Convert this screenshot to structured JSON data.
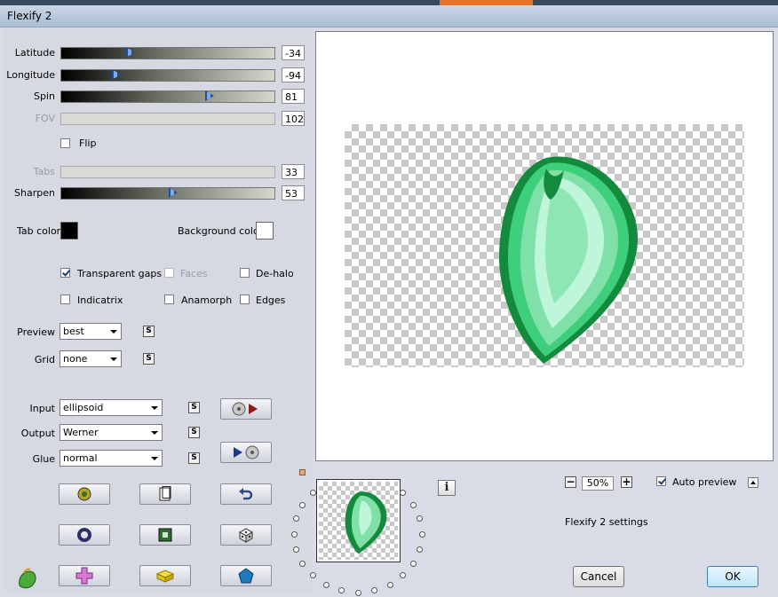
{
  "window": {
    "title": "Flexify 2"
  },
  "sliders": [
    {
      "key": "latitude",
      "label": "Latitude",
      "value": "-34",
      "fraction": 0.32,
      "enabled": true
    },
    {
      "key": "longitude",
      "label": "Longitude",
      "value": "-94",
      "fraction": 0.25,
      "enabled": true
    },
    {
      "key": "spin",
      "label": "Spin",
      "value": "81",
      "fraction": 0.71,
      "enabled": true
    },
    {
      "key": "fov",
      "label": "FOV",
      "value": "102",
      "enabled": false
    },
    {
      "key": "tabs",
      "label": "Tabs",
      "value": "33",
      "enabled": false
    },
    {
      "key": "sharpen",
      "label": "Sharpen",
      "value": "53",
      "fraction": 0.53,
      "enabled": true
    }
  ],
  "flip": {
    "label": "Flip",
    "checked": false
  },
  "colors": {
    "tab_color_label": "Tab color",
    "tab_color": "#000000",
    "background_color_label": "Background color",
    "background_color": "#ffffff"
  },
  "options": {
    "transparent_gaps": {
      "label": "Transparent gaps",
      "checked": true
    },
    "faces": {
      "label": "Faces",
      "checked": false,
      "enabled": false
    },
    "de_halo": {
      "label": "De-halo",
      "checked": false
    },
    "indicatrix": {
      "label": "Indicatrix",
      "checked": false
    },
    "anamorph": {
      "label": "Anamorph",
      "checked": false
    },
    "edges": {
      "label": "Edges",
      "checked": false
    }
  },
  "preview_select": {
    "label": "Preview",
    "value": "best"
  },
  "grid_select": {
    "label": "Grid",
    "value": "none"
  },
  "input_select": {
    "label": "Input",
    "value": "ellipsoid"
  },
  "output_select": {
    "label": "Output",
    "value": "Werner"
  },
  "glue_select": {
    "label": "Glue",
    "value": "normal"
  },
  "small_button_glyph": "S",
  "zoom": {
    "value": "50%",
    "minus": "−",
    "plus": "+"
  },
  "auto_preview": {
    "label": "Auto preview",
    "checked": true
  },
  "settings_label": "Flexify 2 settings",
  "buttons": {
    "cancel": "Cancel",
    "ok": "OK"
  },
  "info_glyph": "i",
  "accent_colors": {
    "leaf_dark": "#138a3c",
    "leaf_mid": "#3ecf7d",
    "leaf_light": "#bff5da"
  }
}
